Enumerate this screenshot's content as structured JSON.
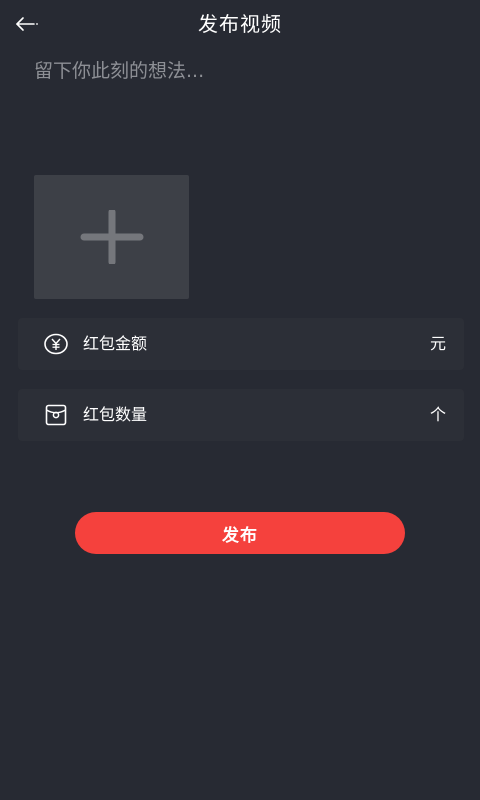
{
  "header": {
    "title": "发布视频",
    "back_icon": "arrow-left-icon"
  },
  "thoughts": {
    "placeholder": "留下你此刻的想法...",
    "value": ""
  },
  "media": {
    "add_icon": "plus-icon"
  },
  "red_packet_amount": {
    "icon": "yen-circle-icon",
    "label": "红包金额",
    "unit": "元"
  },
  "red_packet_count": {
    "icon": "red-packet-icon",
    "label": "红包数量",
    "unit": "个"
  },
  "publish": {
    "label": "发布"
  },
  "colors": {
    "background": "#272a33",
    "row_background": "#2c2f37",
    "media_tile": "#3d4047",
    "accent": "#f5413d",
    "placeholder_text": "#8d8f95"
  }
}
